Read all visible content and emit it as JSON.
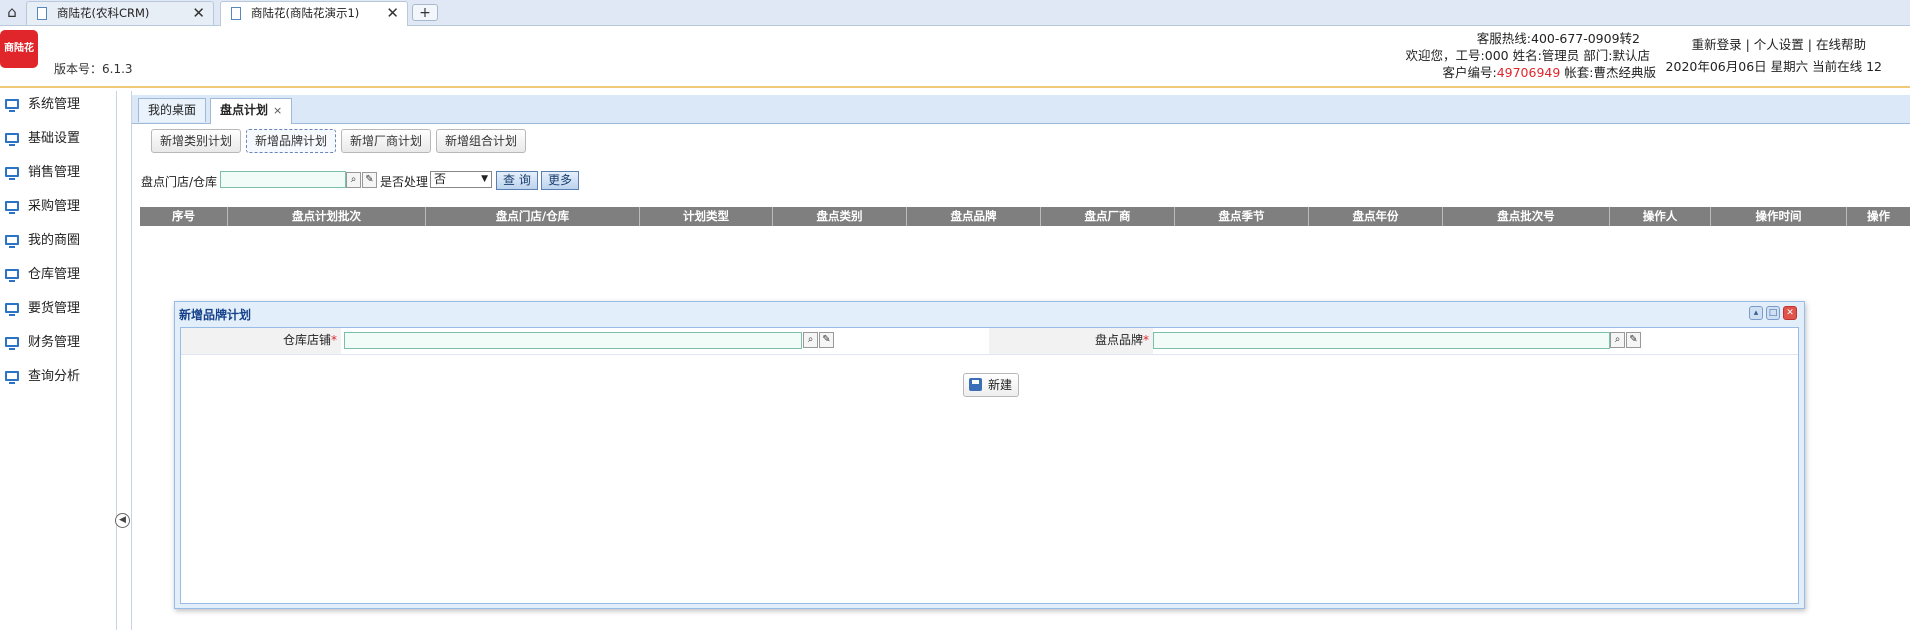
{
  "browser": {
    "tabs": [
      {
        "label": "商陆花(农科CRM)",
        "active": false
      },
      {
        "label": "商陆花(商陆花演示1)",
        "active": true
      }
    ],
    "new_tab": "+",
    "close": "✕",
    "home": "⌂"
  },
  "header": {
    "logo_text": "商陆花",
    "version": "版本号：6.1.3",
    "hotline": "客服热线:400-677-0909转2",
    "welcome": "欢迎您，工号:000 姓名:管理员 部门:默认店",
    "customer_prefix": "客户编号:",
    "customer_no": "49706949",
    "account": " 帐套:曹杰经典版",
    "links": [
      "重新登录",
      "个人设置",
      "在线帮助"
    ],
    "datetime": "2020年06月06日 星期六 当前在线 12"
  },
  "sidebar": {
    "items": [
      "系统管理",
      "基础设置",
      "销售管理",
      "采购管理",
      "我的商圈",
      "仓库管理",
      "要货管理",
      "财务管理",
      "查询分析"
    ],
    "collapse": "◀"
  },
  "content_tabs": [
    {
      "label": "我的桌面",
      "active": false
    },
    {
      "label": "盘点计划",
      "active": true,
      "close": "×"
    }
  ],
  "toolbar": {
    "buttons": [
      "新增类别计划",
      "新增品牌计划",
      "新增厂商计划",
      "新增组合计划"
    ]
  },
  "filter": {
    "store_label": "盘点门店/仓库",
    "store_value": "",
    "processed_label": "是否处理",
    "processed_value": "否",
    "query_btn": "查 询",
    "more_btn": "更多"
  },
  "table": {
    "columns": [
      "序号",
      "盘点计划批次",
      "盘点门店/仓库",
      "计划类型",
      "盘点类别",
      "盘点品牌",
      "盘点厂商",
      "盘点季节",
      "盘点年份",
      "盘点批次号",
      "操作人",
      "操作时间",
      "操作"
    ],
    "rows": []
  },
  "dialog": {
    "title": "新增品牌计划",
    "fields": [
      {
        "label": "仓库店铺",
        "required": "*",
        "value": ""
      },
      {
        "label": "盘点品牌",
        "required": "*",
        "value": ""
      }
    ],
    "new_button": "新建"
  }
}
